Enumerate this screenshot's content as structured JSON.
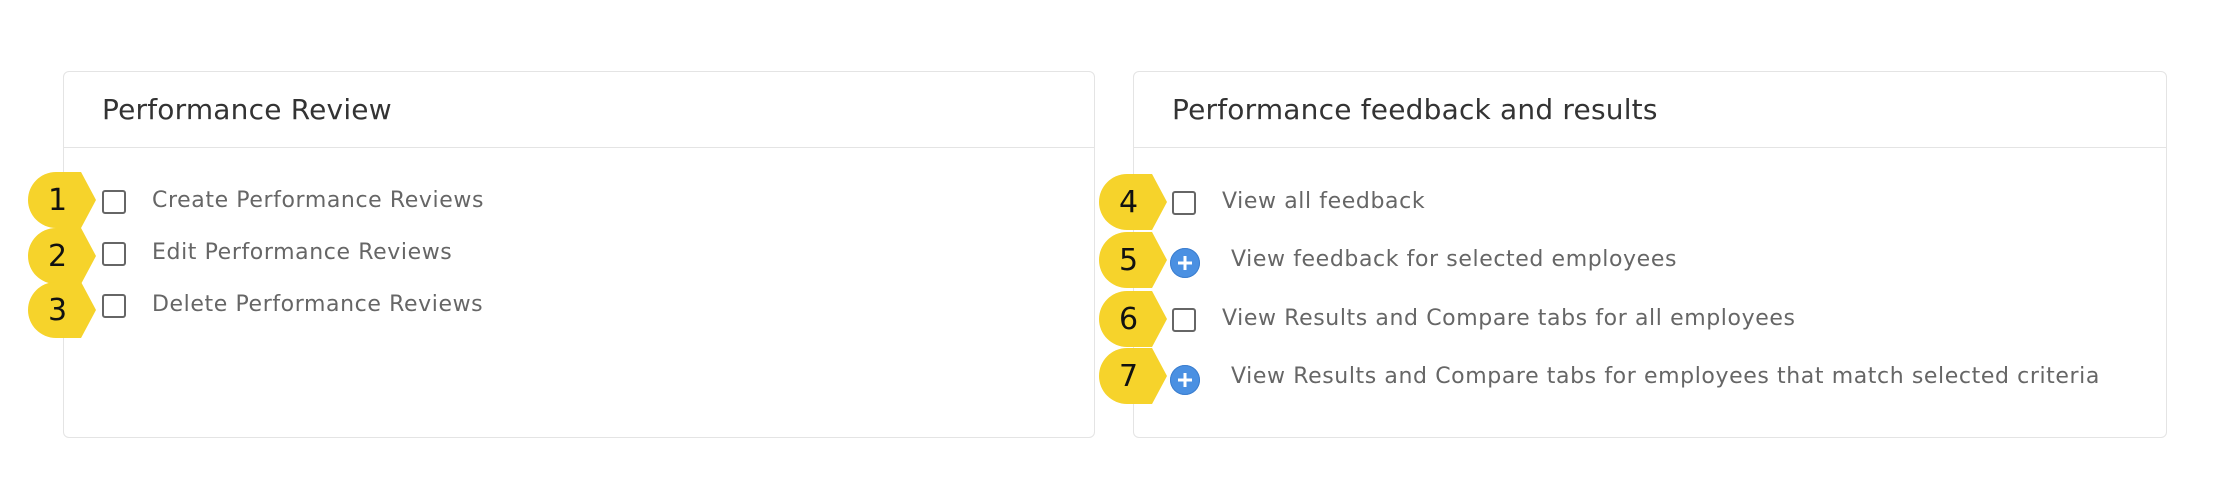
{
  "left_card": {
    "title": "Performance Review",
    "items": [
      {
        "marker": "1",
        "type": "checkbox",
        "label": "Create Performance Reviews"
      },
      {
        "marker": "2",
        "type": "checkbox",
        "label": "Edit Performance Reviews"
      },
      {
        "marker": "3",
        "type": "checkbox",
        "label": "Delete Performance Reviews"
      }
    ]
  },
  "right_card": {
    "title": "Performance feedback and results",
    "items": [
      {
        "marker": "4",
        "type": "checkbox",
        "label": "View all feedback"
      },
      {
        "marker": "5",
        "type": "expand",
        "label": "View feedback for selected employees"
      },
      {
        "marker": "6",
        "type": "checkbox",
        "label": "View Results and Compare tabs for all employees"
      },
      {
        "marker": "7",
        "type": "expand",
        "label": "View Results and Compare tabs for employees that match selected criteria"
      }
    ]
  },
  "colors": {
    "marker": "#f6d32b",
    "plus_button": "#4a90e2",
    "card_border": "#e4e4e4"
  },
  "icons": {
    "checkbox": "empty-square",
    "expand": "plus-circle"
  }
}
